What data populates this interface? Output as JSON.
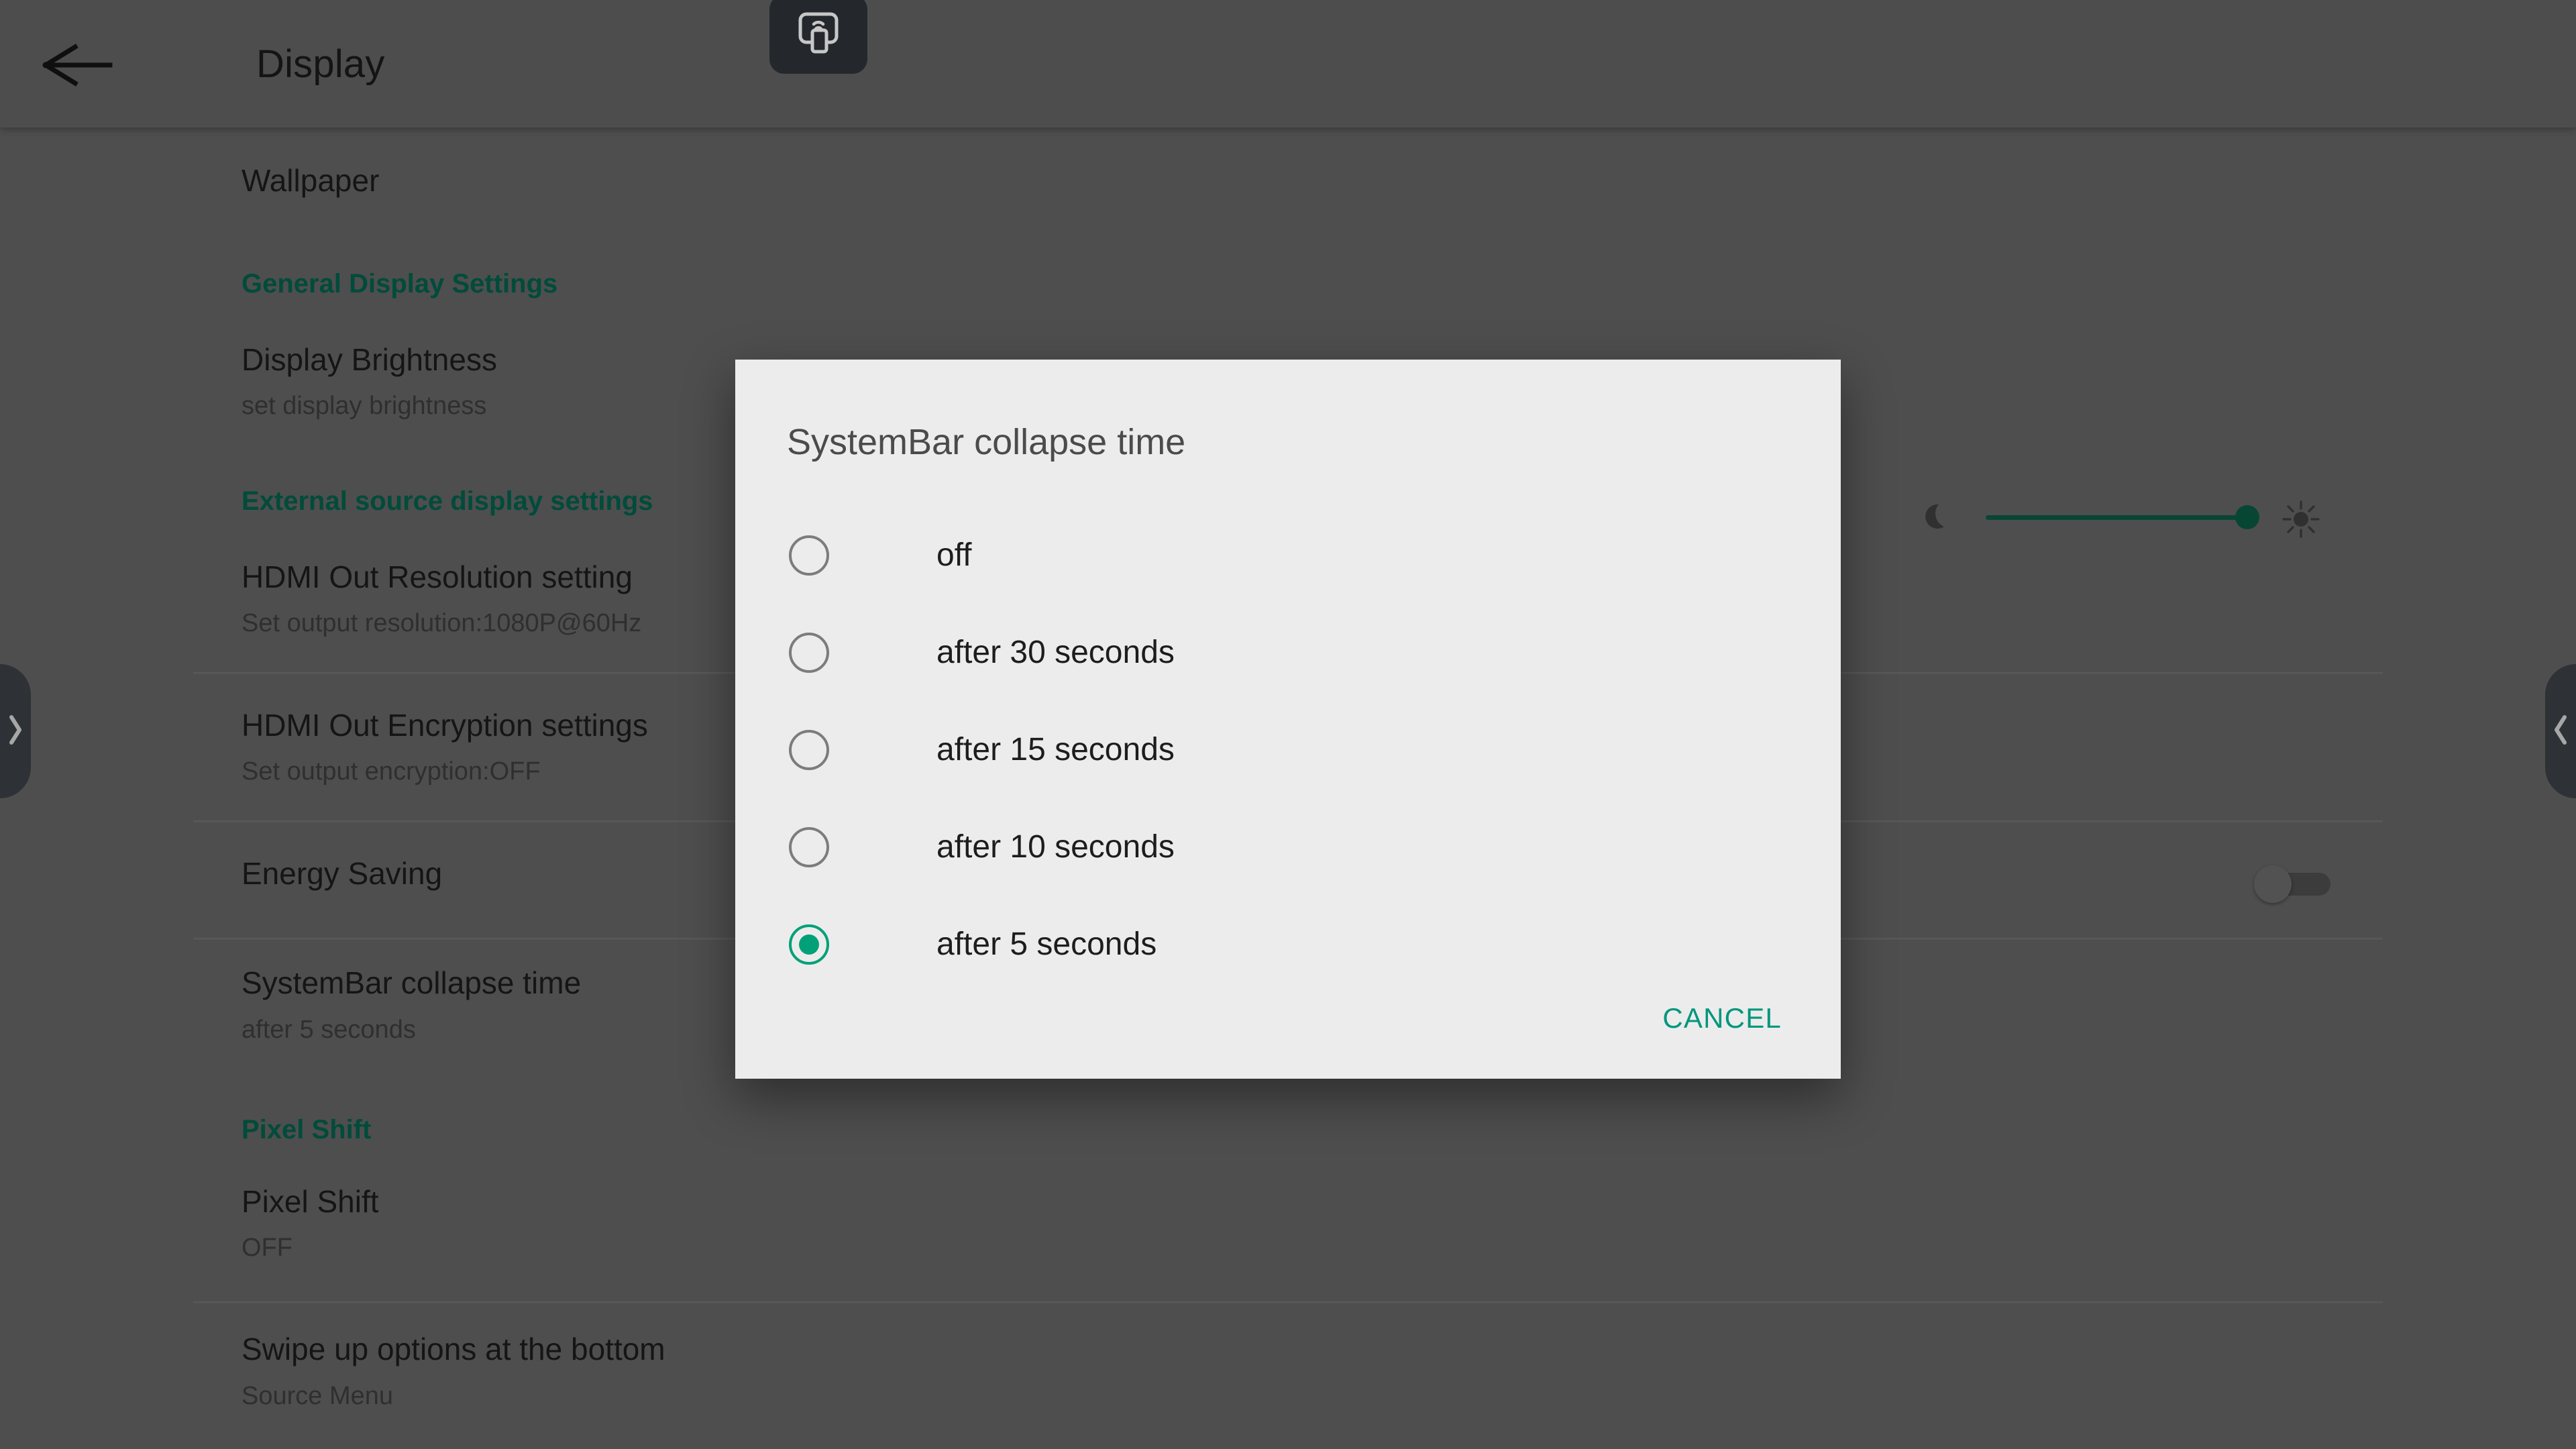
{
  "header": {
    "title": "Display",
    "back_icon": "arrow-left-icon",
    "cast_icon": "screen-cast-icon"
  },
  "edges": {
    "left_handle_icon": "chevron-right-icon",
    "right_handle_icon": "chevron-left-icon"
  },
  "list": [
    {
      "type": "item",
      "title": "Wallpaper",
      "subtitle": ""
    },
    {
      "type": "section",
      "title": "General Display Settings"
    },
    {
      "type": "item",
      "title": "Display Brightness",
      "subtitle": "set display brightness"
    },
    {
      "type": "section",
      "title": "External source display settings"
    },
    {
      "type": "item",
      "title": "HDMI Out Resolution setting",
      "subtitle": "Set output resolution:1080P@60Hz"
    },
    {
      "type": "item",
      "title": "HDMI Out Encryption settings",
      "subtitle": "Set output encryption:OFF"
    },
    {
      "type": "item",
      "title": "Energy Saving",
      "subtitle": ""
    },
    {
      "type": "item",
      "title": "SystemBar collapse time",
      "subtitle": "after 5 seconds"
    },
    {
      "type": "section",
      "title": "Pixel Shift"
    },
    {
      "type": "item",
      "title": "Pixel Shift",
      "subtitle": "OFF"
    },
    {
      "type": "item",
      "title": "Swipe up options at the bottom",
      "subtitle": "Source Menu"
    }
  ],
  "brightness": {
    "low_icon": "moon-icon",
    "high_icon": "sun-icon",
    "value_percent": 93,
    "accent_color": "#0b5a43"
  },
  "energy_saving_toggle": {
    "state": "off"
  },
  "dialog": {
    "title": "SystemBar collapse time",
    "selected_index": 4,
    "options": [
      {
        "label": "off"
      },
      {
        "label": "after 30 seconds"
      },
      {
        "label": "after 15 seconds"
      },
      {
        "label": "after 10 seconds"
      },
      {
        "label": "after 5 seconds"
      }
    ],
    "cancel_label": "CANCEL",
    "accent_color": "#00a178",
    "action_color": "#00967d",
    "background_color": "#ececec"
  },
  "theme": {
    "page_background": "#646464",
    "appbar_background": "#636363",
    "section_header_color": "#01614b",
    "primary_text_color": "#1b1b1b",
    "secondary_text_color": "#3d3d3d"
  }
}
